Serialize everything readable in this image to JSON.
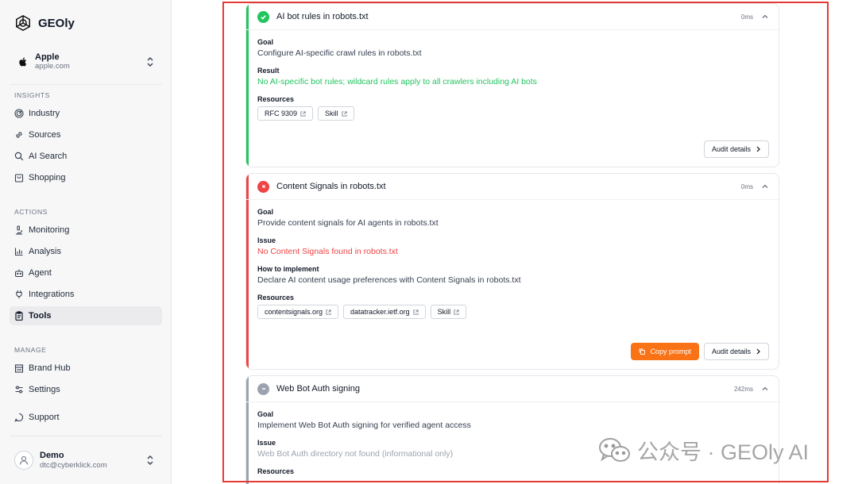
{
  "sidebar": {
    "brand": {
      "name": "GEOly",
      "icon": "geoly-logo-icon"
    },
    "org": {
      "name": "Apple",
      "domain": "apple.com",
      "icon": "apple-icon"
    },
    "sections": {
      "insights": "INSIGHTS",
      "actions": "ACTIONS",
      "manage": "MANAGE"
    },
    "items": {
      "industry": "Industry",
      "sources": "Sources",
      "ai_search": "AI Search",
      "shopping": "Shopping",
      "monitoring": "Monitoring",
      "analysis": "Analysis",
      "agent": "Agent",
      "integrations": "Integrations",
      "tools": "Tools",
      "brand_hub": "Brand Hub",
      "settings": "Settings",
      "support": "Support"
    },
    "active_item": "Tools",
    "user": {
      "name": "Demo",
      "email": "dtc@cyberklick.com"
    }
  },
  "cards": {
    "c1": {
      "title": "AI bot rules in robots.txt",
      "status": "pass",
      "timing": "0ms",
      "goal_label": "Goal",
      "goal": "Configure AI-specific crawl rules in robots.txt",
      "result_label": "Result",
      "result": "No AI-specific bot rules; wildcard rules apply to all crawlers including AI bots",
      "resources_label": "Resources",
      "resources": [
        "RFC 9309",
        "Skill"
      ],
      "audit_label": "Audit details"
    },
    "c2": {
      "title": "Content Signals in robots.txt",
      "status": "fail",
      "timing": "0ms",
      "goal_label": "Goal",
      "goal": "Provide content signals for AI agents in robots.txt",
      "issue_label": "Issue",
      "issue": "No Content Signals found in robots.txt",
      "how_label": "How to implement",
      "how": "Declare AI content usage preferences with Content Signals in robots.txt",
      "resources_label": "Resources",
      "resources": [
        "contentsignals.org",
        "datatracker.ietf.org",
        "Skill"
      ],
      "copy_label": "Copy prompt",
      "audit_label": "Audit details"
    },
    "c3": {
      "title": "Web Bot Auth signing",
      "status": "neutral",
      "timing": "242ms",
      "goal_label": "Goal",
      "goal": "Implement Web Bot Auth signing for verified agent access",
      "issue_label": "Issue",
      "issue": "Web Bot Auth directory not found (informational only)",
      "resources_label": "Resources"
    }
  },
  "colors": {
    "pass": "#22c55e",
    "fail": "#ef4444",
    "neutral": "#9ca3af",
    "accent": "#f97316",
    "highlight_frame": "#e53935"
  },
  "watermark": "公众号 · GEOly AI"
}
